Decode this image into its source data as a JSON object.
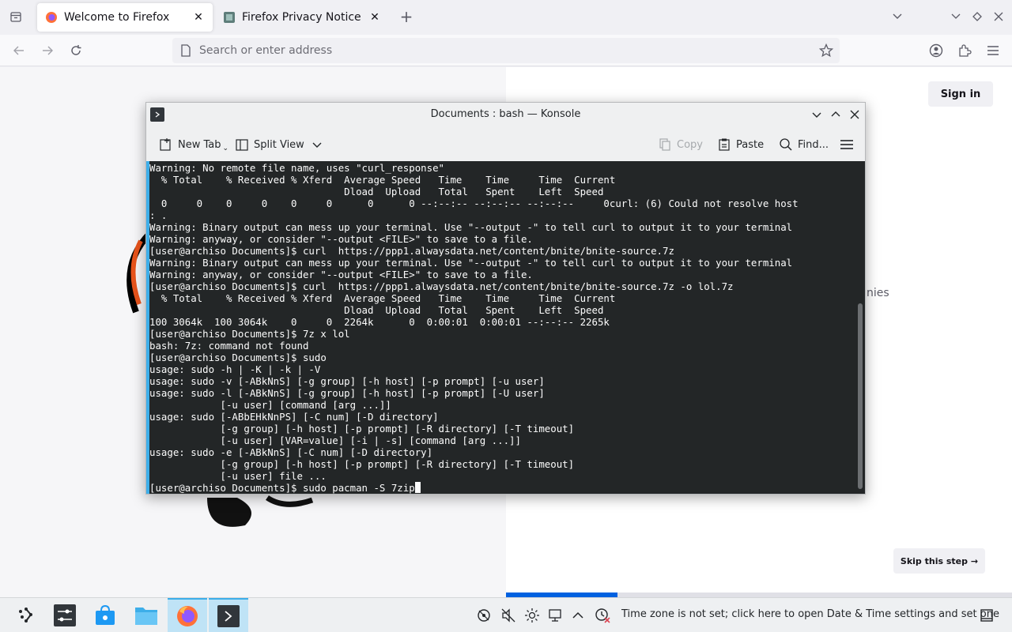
{
  "browser": {
    "tabs": [
      {
        "title": "Welcome to Firefox",
        "active": true
      },
      {
        "title": "Firefox Privacy Notice — M",
        "active": false
      }
    ],
    "url_placeholder": "Search or enter address",
    "page": {
      "sign_in": "Sign in",
      "partial_text": "nies",
      "skip_label": "Skip this step →",
      "progress_fraction": 0.22
    }
  },
  "konsole": {
    "title": "Documents : bash — Konsole",
    "toolbar": {
      "new_tab": "New Tab",
      "split_view": "Split View",
      "copy": "Copy",
      "paste": "Paste",
      "find": "Find..."
    },
    "lines": [
      "Warning: No remote file name, uses \"curl_response\"",
      "  % Total    % Received % Xferd  Average Speed   Time    Time     Time  Current",
      "                                 Dload  Upload   Total   Spent    Left  Speed",
      "  0     0    0     0    0     0      0      0 --:--:-- --:--:-- --:--:--     0curl: (6) Could not resolve host",
      ": .",
      "Warning: Binary output can mess up your terminal. Use \"--output -\" to tell curl to output it to your terminal",
      "Warning: anyway, or consider \"--output <FILE>\" to save to a file.",
      "[user@archiso Documents]$ curl  https://ppp1.alwaysdata.net/content/bnite/bnite-source.7z",
      "Warning: Binary output can mess up your terminal. Use \"--output -\" to tell curl to output it to your terminal",
      "Warning: anyway, or consider \"--output <FILE>\" to save to a file.",
      "[user@archiso Documents]$ curl  https://ppp1.alwaysdata.net/content/bnite/bnite-source.7z -o lol.7z",
      "  % Total    % Received % Xferd  Average Speed   Time    Time     Time  Current",
      "                                 Dload  Upload   Total   Spent    Left  Speed",
      "100 3064k  100 3064k    0     0  2264k      0  0:00:01  0:00:01 --:--:-- 2265k",
      "[user@archiso Documents]$ 7z x lol",
      "bash: 7z: command not found",
      "[user@archiso Documents]$ sudo",
      "usage: sudo -h | -K | -k | -V",
      "usage: sudo -v [-ABkNnS] [-g group] [-h host] [-p prompt] [-u user]",
      "usage: sudo -l [-ABkNnS] [-g group] [-h host] [-p prompt] [-U user]",
      "            [-u user] [command [arg ...]]",
      "usage: sudo [-ABbEHkNnPS] [-C num] [-D directory]",
      "            [-g group] [-h host] [-p prompt] [-R directory] [-T timeout]",
      "            [-u user] [VAR=value] [-i | -s] [command [arg ...]]",
      "usage: sudo -e [-ABkNnS] [-C num] [-D directory]",
      "            [-g group] [-h host] [-p prompt] [-R directory] [-T timeout]",
      "            [-u user] file ...",
      "[user@archiso Documents]$ sudo pacman -S 7zip"
    ]
  },
  "taskbar": {
    "apps": [
      "application-launcher-icon",
      "settings-icon",
      "discover-store-icon",
      "file-manager-icon",
      "firefox-icon",
      "konsole-icon"
    ],
    "tray_notice": "Time zone is not set; click here to open Date & Time settings and set one"
  },
  "colors": {
    "accent": "#3daee9",
    "terminal_bg": "#232627",
    "firefox_blue": "#0061e0"
  }
}
